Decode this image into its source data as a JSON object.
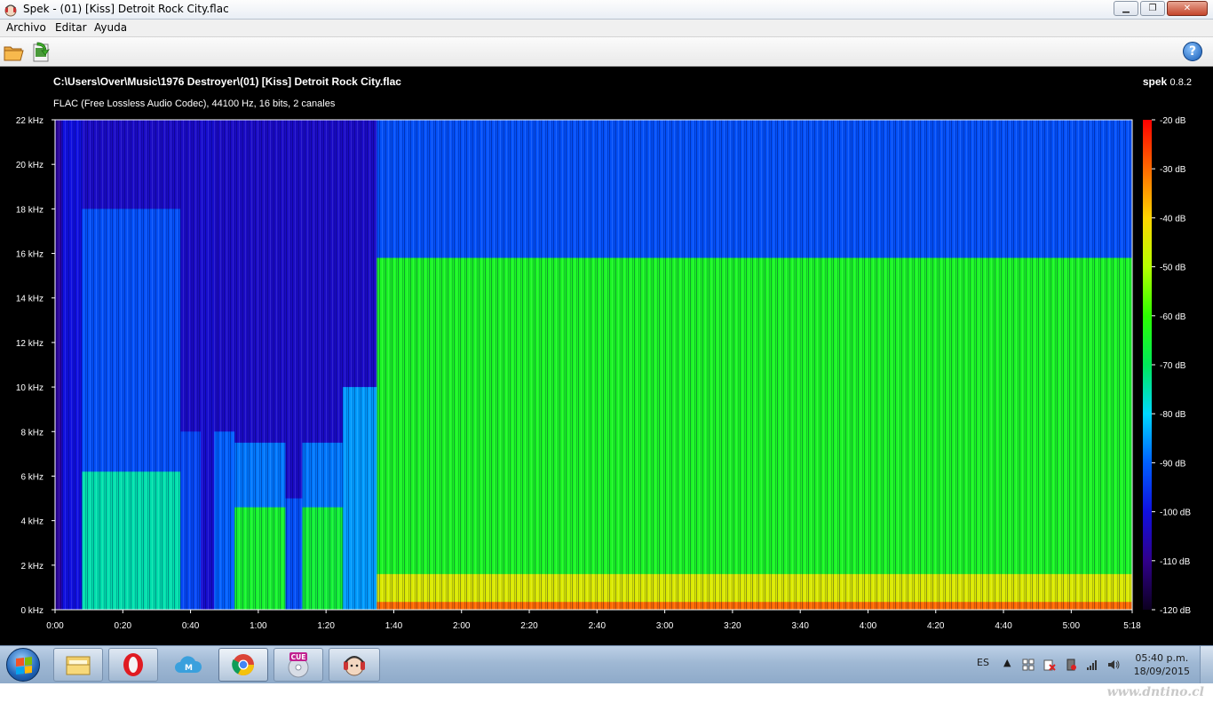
{
  "window": {
    "title": "Spek - (01) [Kiss] Detroit Rock City.flac",
    "minimize_label": "▁",
    "maximize_label": "❐",
    "close_label": "✕"
  },
  "menu": {
    "items": [
      {
        "label": "Archivo"
      },
      {
        "label": "Editar"
      },
      {
        "label": "Ayuda"
      }
    ]
  },
  "toolbar": {
    "open_icon": "folder-open-icon",
    "save_icon": "save-image-icon",
    "help_icon": "help-icon",
    "help_label": "?"
  },
  "file": {
    "path": "C:\\Users\\Over\\Music\\1976 Destroyer\\(01) [Kiss] Detroit Rock City.flac",
    "info": "FLAC (Free Lossless Audio Codec), 44100 Hz, 16 bits, 2 canales"
  },
  "brand": {
    "name": "spek",
    "version": "0.8.2"
  },
  "chart_data": {
    "type": "heatmap",
    "title": "",
    "xlabel": "",
    "ylabel": "",
    "x_ticks": [
      "0:00",
      "0:20",
      "0:40",
      "1:00",
      "1:20",
      "1:40",
      "2:00",
      "2:20",
      "2:40",
      "3:00",
      "3:20",
      "3:40",
      "4:00",
      "4:20",
      "4:40",
      "5:00",
      "5:18"
    ],
    "x_tick_seconds": [
      0,
      20,
      40,
      60,
      80,
      100,
      120,
      140,
      160,
      180,
      200,
      220,
      240,
      260,
      280,
      300,
      318
    ],
    "xlim": [
      0,
      318
    ],
    "y_ticks": [
      "0 kHz",
      "2 kHz",
      "4 kHz",
      "6 kHz",
      "8 kHz",
      "10 kHz",
      "12 kHz",
      "14 kHz",
      "16 kHz",
      "18 kHz",
      "20 kHz",
      "22 kHz"
    ],
    "y_tick_khz": [
      0,
      2,
      4,
      6,
      8,
      10,
      12,
      14,
      16,
      18,
      20,
      22
    ],
    "ylim": [
      0,
      22
    ],
    "colorbar_ticks": [
      "-20 dB",
      "-30 dB",
      "-40 dB",
      "-50 dB",
      "-60 dB",
      "-70 dB",
      "-80 dB",
      "-90 dB",
      "-100 dB",
      "-110 dB",
      "-120 dB"
    ],
    "colorbar_db": [
      -20,
      -30,
      -40,
      -50,
      -60,
      -70,
      -80,
      -90,
      -100,
      -110,
      -120
    ],
    "db_range": [
      -120,
      -20
    ],
    "regions": [
      {
        "t_start": 0,
        "t_end": 2,
        "f_top_khz": 22,
        "level_db": -108
      },
      {
        "t_start": 2,
        "t_end": 8,
        "f_top_khz": 22,
        "level_db": -100
      },
      {
        "t_start": 8,
        "t_end": 37,
        "f_top_khz": 6.2,
        "level_db": -75
      },
      {
        "t_start": 8,
        "t_end": 37,
        "f_top_khz": 18,
        "level_db": -92
      },
      {
        "t_start": 37,
        "t_end": 43,
        "f_top_khz": 8,
        "level_db": -93
      },
      {
        "t_start": 43,
        "t_end": 47,
        "f_top_khz": 22,
        "level_db": -102
      },
      {
        "t_start": 47,
        "t_end": 53,
        "f_top_khz": 8,
        "level_db": -90
      },
      {
        "t_start": 53,
        "t_end": 68,
        "f_top_khz": 4.6,
        "level_db": -65
      },
      {
        "t_start": 53,
        "t_end": 68,
        "f_top_khz": 7.5,
        "level_db": -88
      },
      {
        "t_start": 68,
        "t_end": 73,
        "f_top_khz": 5,
        "level_db": -92
      },
      {
        "t_start": 73,
        "t_end": 85,
        "f_top_khz": 4.6,
        "level_db": -66
      },
      {
        "t_start": 73,
        "t_end": 85,
        "f_top_khz": 7.5,
        "level_db": -88
      },
      {
        "t_start": 85,
        "t_end": 95,
        "f_top_khz": 10,
        "level_db": -85
      },
      {
        "t_start": 95,
        "t_end": 318,
        "f_top_khz": 15.8,
        "level_db": -64
      },
      {
        "t_start": 95,
        "t_end": 318,
        "f_top_khz": 22,
        "level_db": -92
      },
      {
        "t_start": 95,
        "t_end": 318,
        "f_top_khz": 1.6,
        "level_db": -45
      }
    ]
  },
  "taskbar": {
    "apps": [
      {
        "name": "explorer",
        "icon": "folder-icon"
      },
      {
        "name": "opera",
        "icon": "opera-icon"
      },
      {
        "name": "mega",
        "icon": "cloud-icon"
      },
      {
        "name": "chrome",
        "icon": "chrome-icon"
      },
      {
        "name": "cue",
        "icon": "cue-disc-icon",
        "label": "CUE"
      },
      {
        "name": "spek",
        "icon": "spek-icon"
      }
    ],
    "language": "ES",
    "time": "05:40 p.m.",
    "date": "18/09/2015"
  },
  "watermark": "www.dntino.cl"
}
